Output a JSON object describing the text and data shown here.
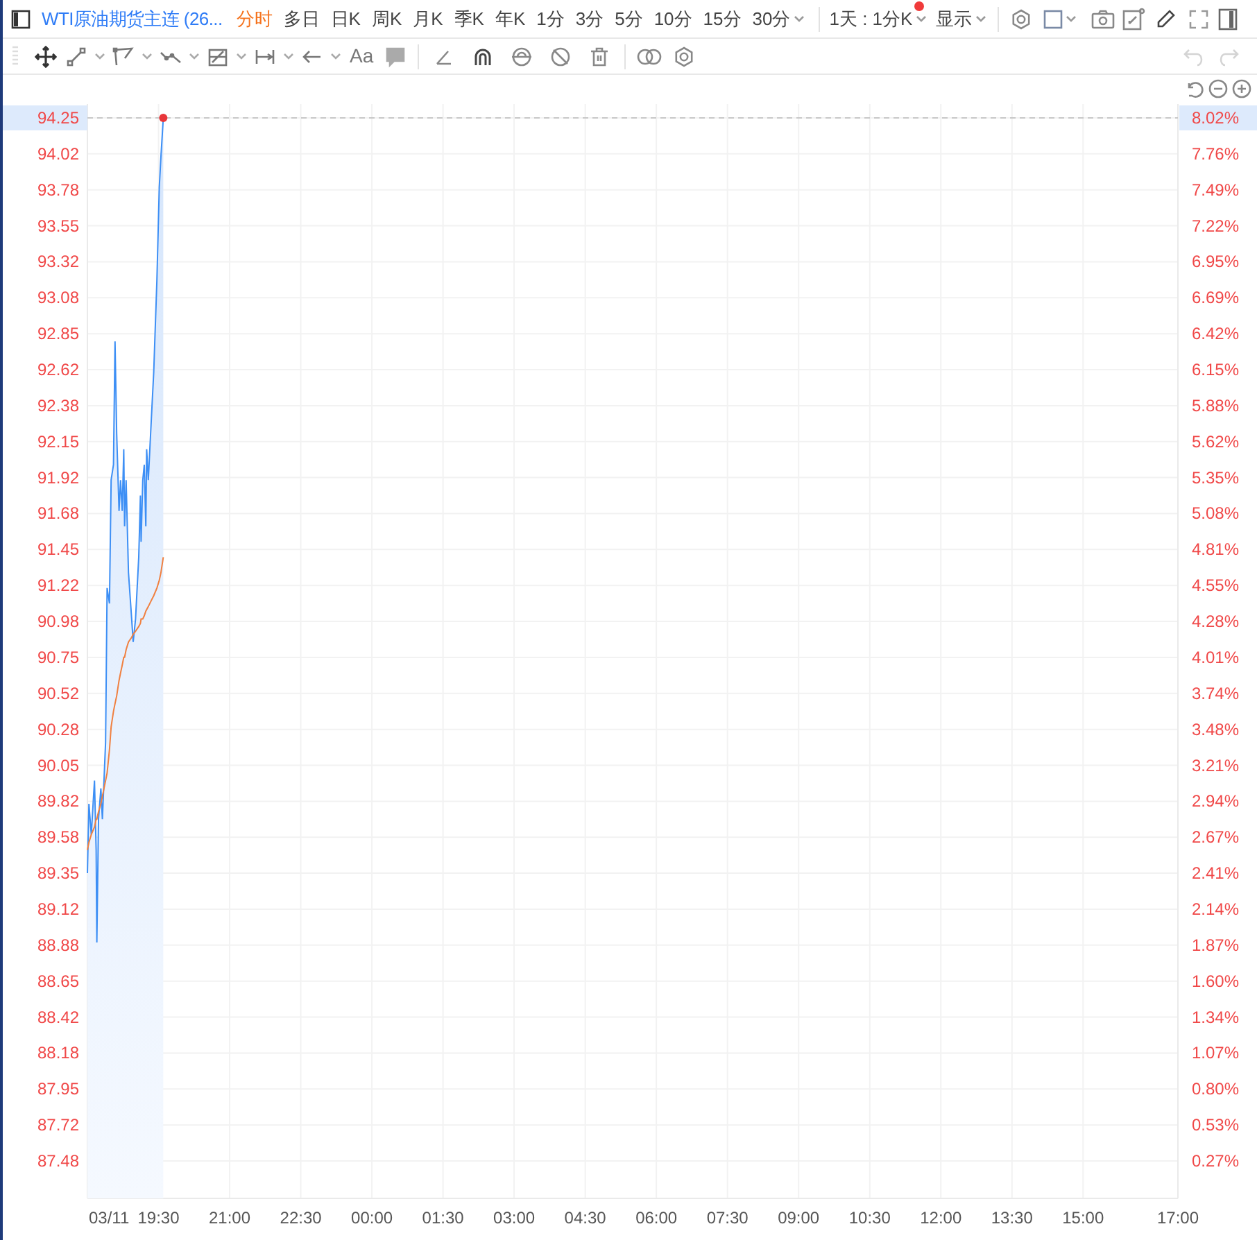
{
  "toolbar": {
    "title": "WTI原油期货主连 (26...",
    "periods": [
      {
        "label": "分时",
        "selected": true,
        "kind": "tab"
      },
      {
        "label": "多日",
        "selected": false,
        "kind": "tab"
      },
      {
        "label": "日K",
        "selected": false,
        "kind": "tab"
      },
      {
        "label": "周K",
        "selected": false,
        "kind": "tab"
      },
      {
        "label": "月K",
        "selected": false,
        "kind": "tab"
      },
      {
        "label": "季K",
        "selected": false,
        "kind": "tab"
      },
      {
        "label": "年K",
        "selected": false,
        "kind": "tab"
      },
      {
        "label": "1分",
        "selected": false,
        "kind": "tab"
      },
      {
        "label": "3分",
        "selected": false,
        "kind": "tab"
      },
      {
        "label": "5分",
        "selected": false,
        "kind": "tab"
      },
      {
        "label": "10分",
        "selected": false,
        "kind": "tab"
      },
      {
        "label": "15分",
        "selected": false,
        "kind": "tab"
      },
      {
        "label": "30分",
        "selected": false,
        "kind": "dropdown"
      }
    ],
    "range": {
      "label": "1天 : 1分K",
      "notification": true
    },
    "display": {
      "label": "显示"
    }
  },
  "drawing_toolbar": {
    "undo_disabled": true,
    "redo_disabled": true,
    "text_tool": "Aa"
  },
  "chart": {
    "time_labels": [
      "03/11",
      "19:30",
      "21:00",
      "22:30",
      "00:00",
      "01:30",
      "03:00",
      "04:30",
      "06:00",
      "07:30",
      "09:00",
      "10:30",
      "12:00",
      "13:30",
      "15:00",
      "17:00"
    ],
    "price_labels": [
      {
        "label": "94.25",
        "current": true
      },
      {
        "label": "94.02",
        "current": false
      },
      {
        "label": "93.78",
        "current": false
      },
      {
        "label": "93.55",
        "current": false
      },
      {
        "label": "93.32",
        "current": false
      },
      {
        "label": "93.08",
        "current": false
      },
      {
        "label": "92.85",
        "current": false
      },
      {
        "label": "92.62",
        "current": false
      },
      {
        "label": "92.38",
        "current": false
      },
      {
        "label": "92.15",
        "current": false
      },
      {
        "label": "91.92",
        "current": false
      },
      {
        "label": "91.68",
        "current": false
      },
      {
        "label": "91.45",
        "current": false
      },
      {
        "label": "91.22",
        "current": false
      },
      {
        "label": "90.98",
        "current": false
      },
      {
        "label": "90.75",
        "current": false
      },
      {
        "label": "90.52",
        "current": false
      },
      {
        "label": "90.28",
        "current": false
      },
      {
        "label": "90.05",
        "current": false
      },
      {
        "label": "89.82",
        "current": false
      },
      {
        "label": "89.58",
        "current": false
      },
      {
        "label": "89.35",
        "current": false
      },
      {
        "label": "89.12",
        "current": false
      },
      {
        "label": "88.88",
        "current": false
      },
      {
        "label": "88.65",
        "current": false
      },
      {
        "label": "88.42",
        "current": false
      },
      {
        "label": "88.18",
        "current": false
      },
      {
        "label": "87.95",
        "current": false
      },
      {
        "label": "87.72",
        "current": false
      },
      {
        "label": "87.48",
        "current": false
      }
    ],
    "percent_labels": [
      {
        "label": "8.02%",
        "current": true
      },
      {
        "label": "7.76%",
        "current": false
      },
      {
        "label": "7.49%",
        "current": false
      },
      {
        "label": "7.22%",
        "current": false
      },
      {
        "label": "6.95%",
        "current": false
      },
      {
        "label": "6.69%",
        "current": false
      },
      {
        "label": "6.42%",
        "current": false
      },
      {
        "label": "6.15%",
        "current": false
      },
      {
        "label": "5.88%",
        "current": false
      },
      {
        "label": "5.62%",
        "current": false
      },
      {
        "label": "5.35%",
        "current": false
      },
      {
        "label": "5.08%",
        "current": false
      },
      {
        "label": "4.81%",
        "current": false
      },
      {
        "label": "4.55%",
        "current": false
      },
      {
        "label": "4.28%",
        "current": false
      },
      {
        "label": "4.01%",
        "current": false
      },
      {
        "label": "3.74%",
        "current": false
      },
      {
        "label": "3.48%",
        "current": false
      },
      {
        "label": "3.21%",
        "current": false
      },
      {
        "label": "2.94%",
        "current": false
      },
      {
        "label": "2.67%",
        "current": false
      },
      {
        "label": "2.41%",
        "current": false
      },
      {
        "label": "2.14%",
        "current": false
      },
      {
        "label": "1.87%",
        "current": false
      },
      {
        "label": "1.60%",
        "current": false
      },
      {
        "label": "1.34%",
        "current": false
      },
      {
        "label": "1.07%",
        "current": false
      },
      {
        "label": "0.80%",
        "current": false
      },
      {
        "label": "0.53%",
        "current": false
      },
      {
        "label": "0.27%",
        "current": false
      }
    ]
  }
}
